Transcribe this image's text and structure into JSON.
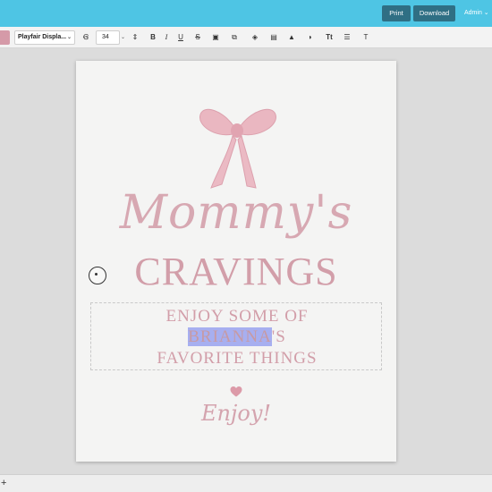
{
  "header": {
    "print_label": "Print",
    "download_label": "Download",
    "user_label": "Admin ⌄"
  },
  "toolbar": {
    "font_family_value": "Playfair Displa...",
    "font_size_value": "34",
    "tools": [
      {
        "name": "text-color-icon",
        "glyph": "Ꞡ"
      },
      {
        "name": "line-height-icon",
        "glyph": "⇕"
      },
      {
        "name": "bold-icon",
        "glyph": "B"
      },
      {
        "name": "italic-icon",
        "glyph": "I"
      },
      {
        "name": "underline-icon",
        "glyph": "U"
      },
      {
        "name": "strikethrough-icon",
        "glyph": "S"
      },
      {
        "name": "image-icon",
        "glyph": "▣"
      },
      {
        "name": "duplicate-icon",
        "glyph": "⧉"
      },
      {
        "name": "layers-icon",
        "glyph": "◈"
      },
      {
        "name": "align-icon",
        "glyph": "▤"
      },
      {
        "name": "lock-icon",
        "glyph": "🔒"
      },
      {
        "name": "opacity-icon",
        "glyph": "◑"
      },
      {
        "name": "text-transform-icon",
        "glyph": "Tt"
      },
      {
        "name": "list-icon",
        "glyph": "☰"
      },
      {
        "name": "clear-format-icon",
        "glyph": "T̸"
      }
    ],
    "swatch_color": "#d59aa8"
  },
  "document": {
    "script_title": "Mommy's",
    "title": "CRAVINGS",
    "line1": "ENJOY SOME OF",
    "line2_selected": "BRIANNA",
    "line2_rest": "'S",
    "line3": "FAVORITE THINGS",
    "footer": "Enjoy!",
    "accent_color": "#d29ea9"
  },
  "bottombar": {
    "add_label": "+"
  }
}
